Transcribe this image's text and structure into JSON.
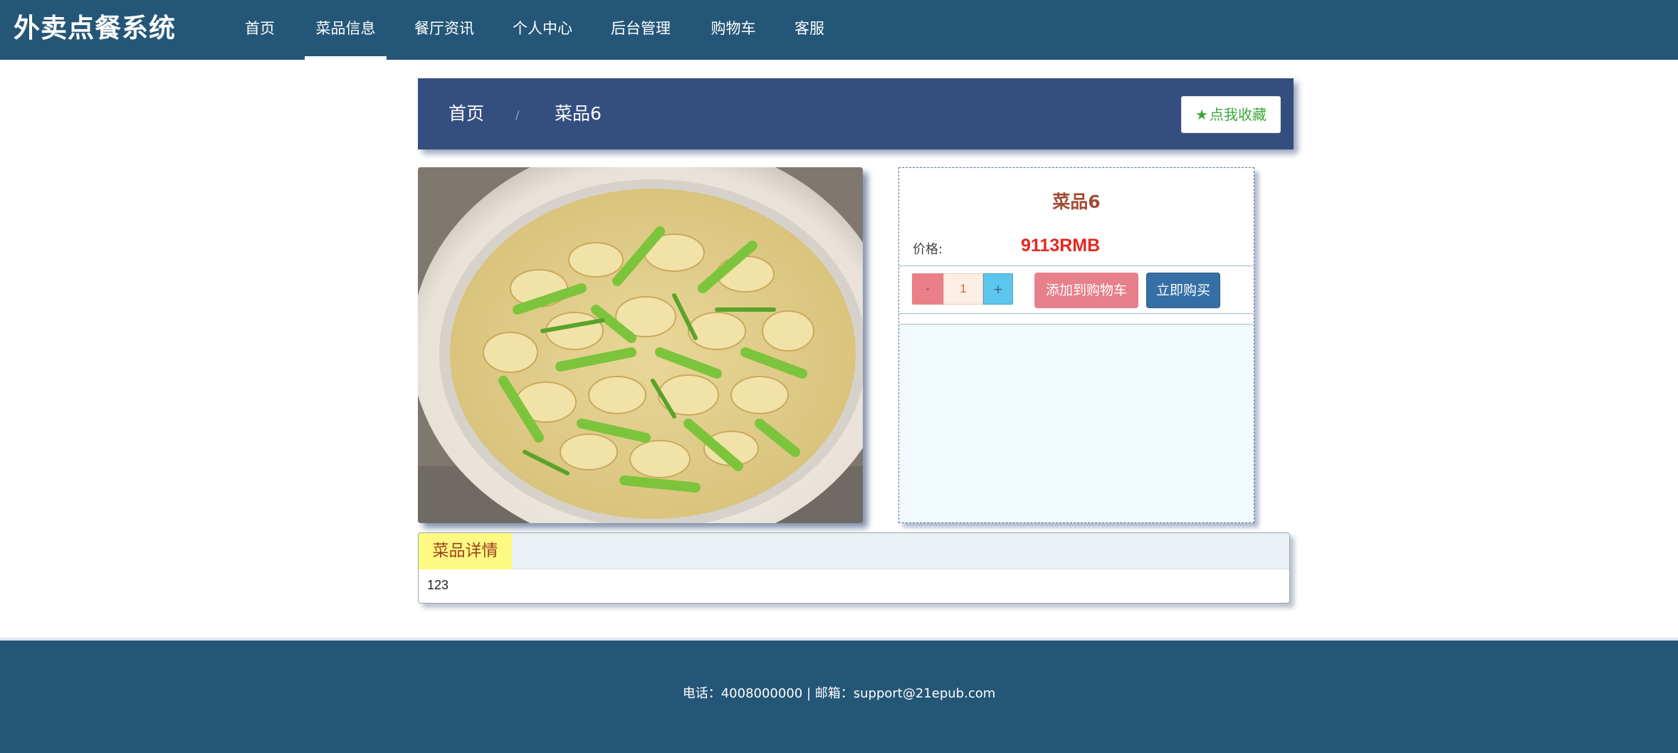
{
  "header": {
    "brand": "外卖点餐系统",
    "nav": [
      {
        "label": "首页"
      },
      {
        "label": "菜品信息"
      },
      {
        "label": "餐厅资讯"
      },
      {
        "label": "个人中心"
      },
      {
        "label": "后台管理"
      },
      {
        "label": "购物车"
      },
      {
        "label": "客服"
      }
    ],
    "active_nav": "菜品信息"
  },
  "breadcrumb": {
    "home": "首页",
    "separator": "/",
    "current": "菜品6",
    "favorite_label": "点我收藏",
    "favorite_icon": "star-icon"
  },
  "product": {
    "image_alt": "dish-photo",
    "name": "菜品6",
    "price_label": "价格:",
    "price": "9113RMB",
    "qty_minus": "-",
    "quantity": "1",
    "qty_plus": "+",
    "add_to_cart": "添加到购物车",
    "buy_now": "立即购买"
  },
  "detail": {
    "tab_label": "菜品详情",
    "content": "123"
  },
  "footer": {
    "text": "电话：4008000000 | 邮箱：support@21epub.com"
  },
  "colors": {
    "nav_bg": "#245677",
    "breadcrumb_bg": "#344f7f",
    "price": "#e5261f",
    "title": "#a14d34",
    "add_cart_bg": "#e7808a",
    "buy_now_bg": "#356fa6"
  }
}
